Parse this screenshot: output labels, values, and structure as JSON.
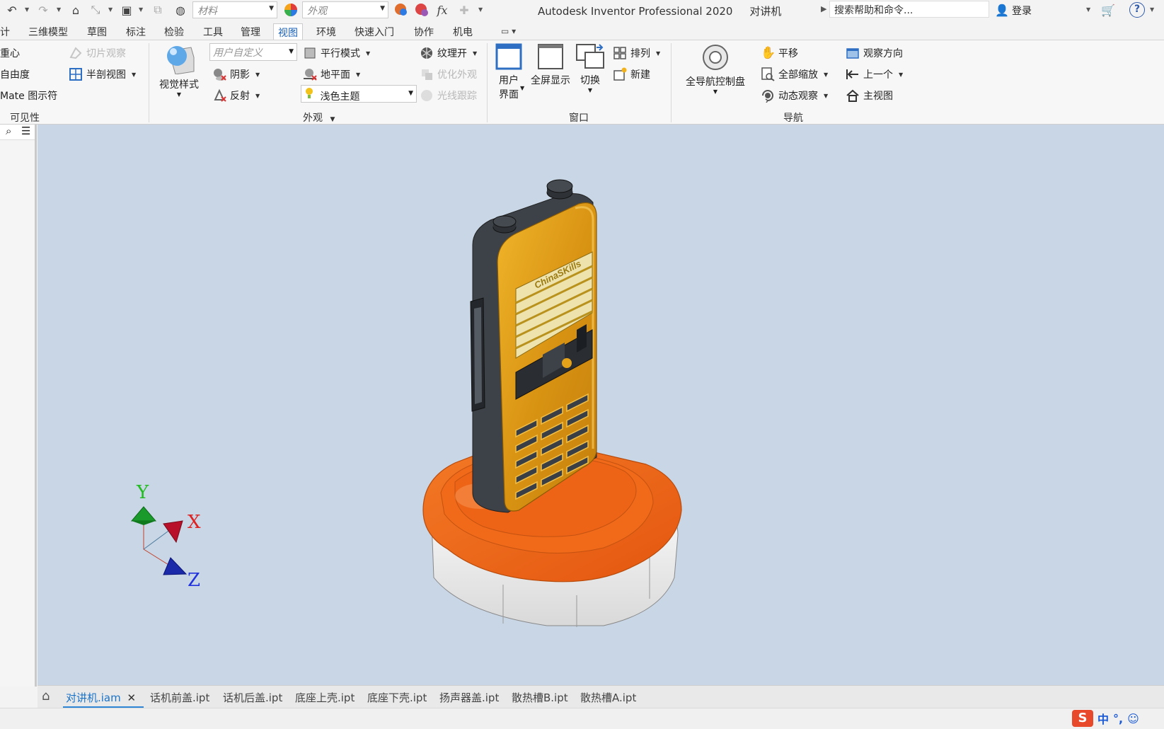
{
  "quick_access": {
    "material_placeholder": "材料",
    "appearance_placeholder": "外观",
    "fx_label": "fx",
    "app_title": "Autodesk Inventor Professional 2020",
    "doc_title": "对讲机",
    "search_placeholder": "搜索帮助和命令...",
    "login_label": "登录",
    "help_label": "?"
  },
  "tabs": [
    {
      "label": "计"
    },
    {
      "label": "三维模型"
    },
    {
      "label": "草图"
    },
    {
      "label": "标注"
    },
    {
      "label": "检验"
    },
    {
      "label": "工具"
    },
    {
      "label": "管理"
    },
    {
      "label": "视图",
      "active": true
    },
    {
      "label": "环境"
    },
    {
      "label": "快速入门"
    },
    {
      "label": "协作"
    },
    {
      "label": "机电"
    }
  ],
  "ribbon": {
    "visibility": {
      "title": "可见性",
      "items": [
        "重心",
        "自由度",
        "Mate 图示符"
      ],
      "slice_label": "切片观察",
      "half_section_label": "半剖视图"
    },
    "appearance": {
      "title": "外观",
      "visual_style_label": "视觉样式",
      "user_defined_placeholder": "用户自定义",
      "shadow_label": "阴影",
      "reflection_label": "反射",
      "parallel_label": "平行模式",
      "ground_label": "地平面",
      "theme_value": "浅色主题",
      "texture_label": "纹理开",
      "optimize_label": "优化外观",
      "raytrace_label": "光线跟踪"
    },
    "window": {
      "title": "窗口",
      "user_interface_label_1": "用户",
      "user_interface_label_2": "界面",
      "fullscreen_label": "全屏显示",
      "switch_label": "切换",
      "arrange_label": "排列",
      "new_label": "新建"
    },
    "navigate": {
      "title": "导航",
      "steering_wheel_label": "全导航控制盘",
      "pan_label": "平移",
      "zoom_all_label": "全部缩放",
      "orbit_label": "动态观察",
      "look_at_label": "观察方向",
      "previous_label": "上一个",
      "home_label": "主视图"
    }
  },
  "viewport": {
    "brand_text": "ChinaSKills",
    "axis_x": "X",
    "axis_y": "Y",
    "axis_z": "Z"
  },
  "doc_tabs": [
    {
      "label": "对讲机.iam",
      "active": true
    },
    {
      "label": "话机前盖.ipt"
    },
    {
      "label": "话机后盖.ipt"
    },
    {
      "label": "底座上壳.ipt"
    },
    {
      "label": "底座下壳.ipt"
    },
    {
      "label": "扬声器盖.ipt"
    },
    {
      "label": "散热槽B.ipt"
    },
    {
      "label": "散热槽A.ipt"
    }
  ],
  "ime": {
    "lang": "中",
    "punct": "°,"
  },
  "colors": {
    "viewport_bg": "#c9d6e6",
    "base_orange": "#f06a1a",
    "body_gold": "#e3a21a",
    "body_dark": "#3d4248",
    "accent_blue": "#1a73c7"
  }
}
